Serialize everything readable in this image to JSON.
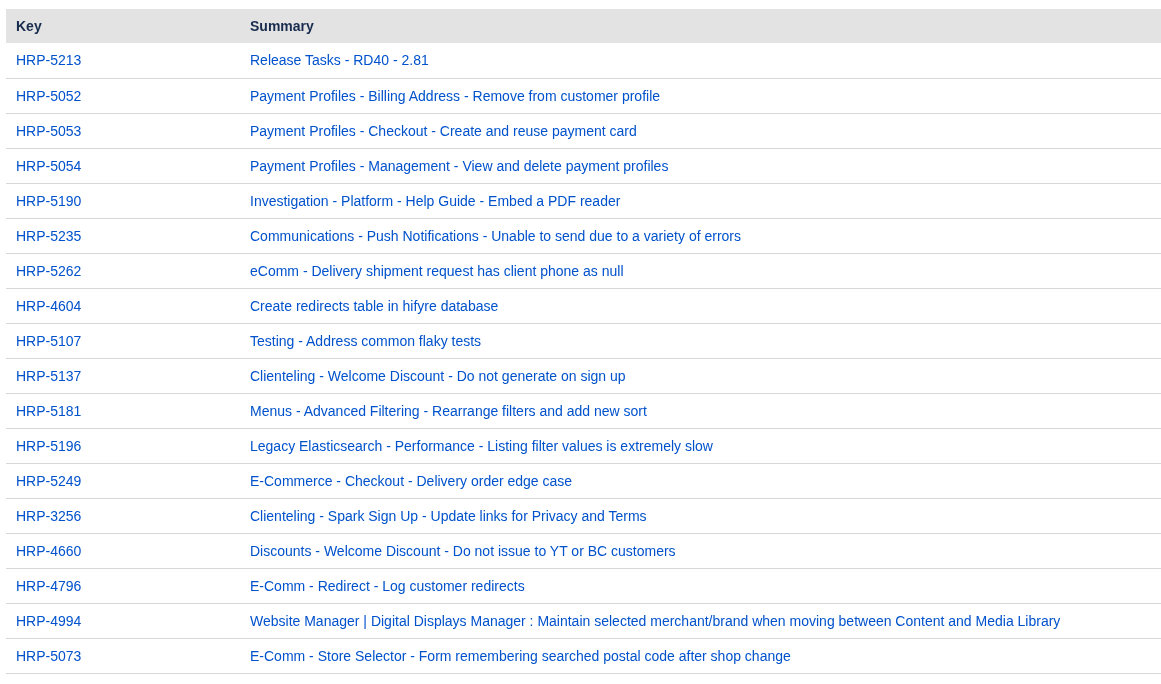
{
  "table": {
    "columns": [
      "Key",
      "Summary"
    ],
    "rows": [
      {
        "key": "HRP-5213",
        "summary": "Release Tasks - RD40 - 2.81"
      },
      {
        "key": "HRP-5052",
        "summary": "Payment Profiles - Billing Address - Remove from customer profile"
      },
      {
        "key": "HRP-5053",
        "summary": "Payment Profiles - Checkout - Create and reuse payment card"
      },
      {
        "key": "HRP-5054",
        "summary": "Payment Profiles - Management - View and delete payment profiles"
      },
      {
        "key": "HRP-5190",
        "summary": "Investigation - Platform - Help Guide - Embed a PDF reader"
      },
      {
        "key": "HRP-5235",
        "summary": "Communications - Push Notifications - Unable to send due to a variety of errors"
      },
      {
        "key": "HRP-5262",
        "summary": "eComm - Delivery shipment request has client phone as null"
      },
      {
        "key": "HRP-4604",
        "summary": "Create redirects table in hifyre database"
      },
      {
        "key": "HRP-5107",
        "summary": "Testing - Address common flaky tests"
      },
      {
        "key": "HRP-5137",
        "summary": "Clienteling - Welcome Discount - Do not generate on sign up"
      },
      {
        "key": "HRP-5181",
        "summary": "Menus - Advanced Filtering - Rearrange filters and add new sort"
      },
      {
        "key": "HRP-5196",
        "summary": "Legacy Elasticsearch - Performance - Listing filter values is extremely slow"
      },
      {
        "key": "HRP-5249",
        "summary": "E-Commerce - Checkout - Delivery order edge case"
      },
      {
        "key": "HRP-3256",
        "summary": "Clienteling - Spark Sign Up - Update links for Privacy and Terms"
      },
      {
        "key": "HRP-4660",
        "summary": "Discounts - Welcome Discount - Do not issue to YT or BC customers"
      },
      {
        "key": "HRP-4796",
        "summary": "E-Comm - Redirect - Log customer redirects"
      },
      {
        "key": "HRP-4994",
        "summary": "Website Manager | Digital Displays Manager : Maintain selected merchant/brand when moving between Content and Media Library"
      },
      {
        "key": "HRP-5073",
        "summary": "E-Comm - Store Selector - Form remembering searched postal code after shop change"
      }
    ]
  }
}
